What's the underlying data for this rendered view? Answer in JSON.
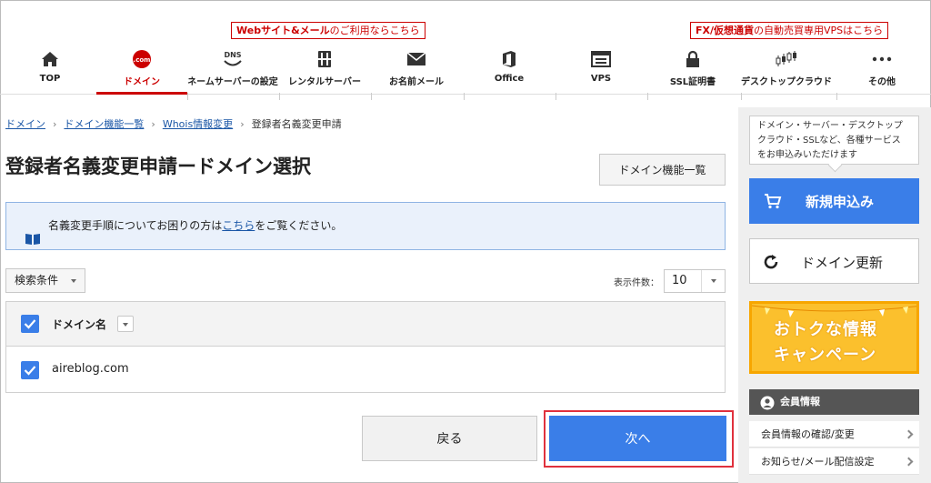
{
  "promos": {
    "web_bold": "Webサイト&メール",
    "web_rest": "のご利用ならこちら",
    "fx_bold": "FX/仮想通貨",
    "fx_rest": "の自動売買専用VPSはこちら"
  },
  "nav": {
    "items": [
      {
        "label": "TOP",
        "icon": "home-icon"
      },
      {
        "label": "ドメイン",
        "icon": "dotcom-icon",
        "icon_text": ".com",
        "active": true
      },
      {
        "label": "ネームサーバーの設定",
        "icon": "dns-icon",
        "icon_text": "DNS"
      },
      {
        "label": "レンタルサーバー",
        "icon": "server-icon"
      },
      {
        "label": "お名前メール",
        "icon": "mail-icon"
      },
      {
        "label": "Office",
        "icon": "office-icon"
      },
      {
        "label": "VPS",
        "icon": "vps-icon"
      },
      {
        "label": "SSL証明書",
        "icon": "lock-icon"
      },
      {
        "label": "デスクトップクラウド",
        "icon": "candlestick-icon"
      },
      {
        "label": "その他",
        "icon": "more-icon"
      }
    ]
  },
  "breadcrumb": {
    "items": [
      "ドメイン",
      "ドメイン機能一覧",
      "Whois情報変更"
    ],
    "current": "登録者名義変更申請"
  },
  "page": {
    "title": "登録者名義変更申請ードメイン選択",
    "func_list_button": "ドメイン機能一覧"
  },
  "info": {
    "before": "名義変更手順についてお困りの方は",
    "link": "こちら",
    "after": "をご覧ください。"
  },
  "filter": {
    "label": "検索条件",
    "count_label": "表示件数：",
    "count_value": "10"
  },
  "table": {
    "header": "ドメイン名",
    "rows": [
      {
        "domain": "aireblog.com",
        "checked": true
      }
    ]
  },
  "actions": {
    "back": "戻る",
    "next": "次へ"
  },
  "sidebar": {
    "bubble_line1": "ドメイン・サーバー・デスクトップ",
    "bubble_line2": "クラウド・SSLなど、各種サービス",
    "bubble_line3": "をお申込みいただけます",
    "new_order": "新規申込み",
    "renew": "ドメイン更新",
    "campaign_line1": "おトクな情報",
    "campaign_line2": "キャンペーン",
    "member_title": "会員情報",
    "member_links": [
      "会員情報の確認/変更",
      "お知らせ/メール配信設定"
    ]
  },
  "colors": {
    "brand_red": "#cc0000",
    "primary_blue": "#3a7ee8",
    "highlight_red": "#e0313d",
    "campaign_yellow": "#fbc02d"
  }
}
